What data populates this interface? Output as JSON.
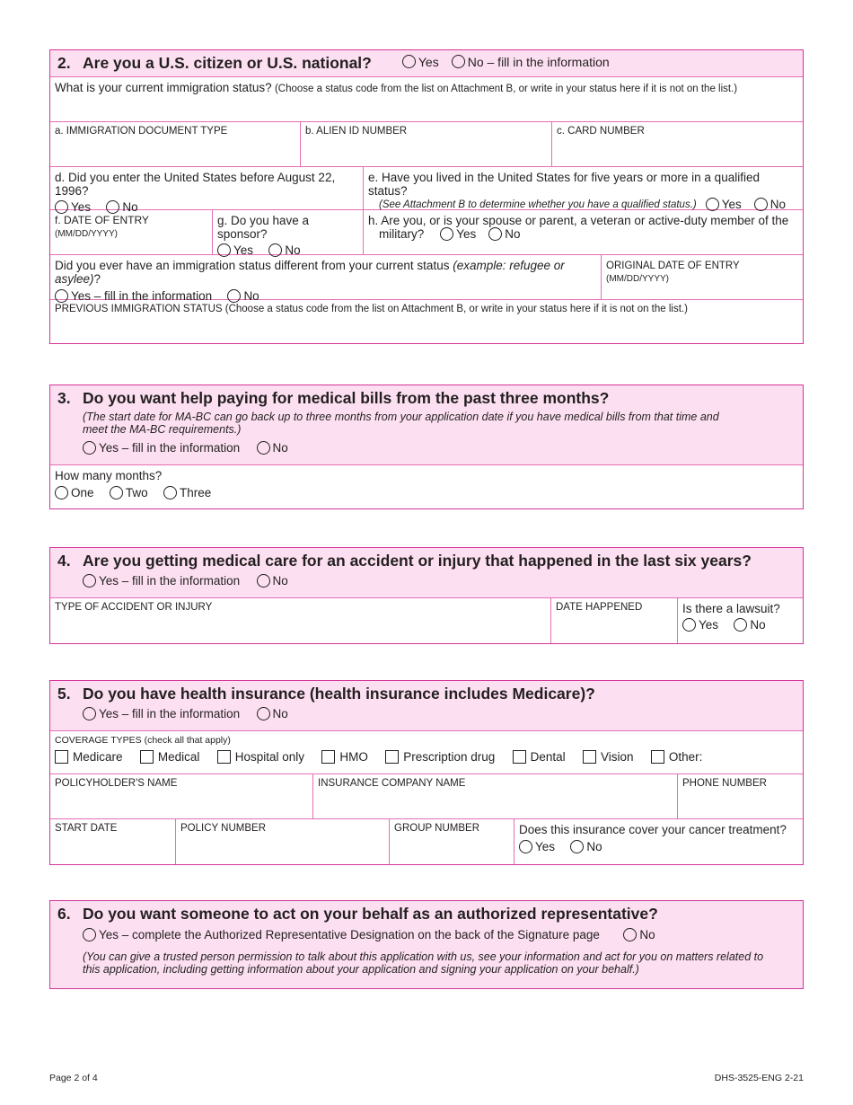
{
  "s2": {
    "num": "2.",
    "title": "Are you a U.S. citizen or U.S. national?",
    "yes": "Yes",
    "no": "No – fill in the information",
    "status_q": "What is your current immigration status?",
    "status_note": "(Choose a status code from the list on Attachment B, or write in your status here if it is not on the list.)",
    "a": "a. IMMIGRATION DOCUMENT TYPE",
    "b": "b. ALIEN ID NUMBER",
    "c": "c. CARD NUMBER",
    "d": "d. Did you enter the United States before August 22, 1996?",
    "e": "e. Have you lived in the United States for five years or more in a qualified status?",
    "e_note": "(See Attachment B to determine whether you have a qualified status.)",
    "f": "f. DATE OF ENTRY",
    "f_fmt": "(MM/DD/YYYY)",
    "g": "g. Do you have a sponsor?",
    "h1": "h. Are you, or is your spouse or parent, a veteran or active-duty member of the",
    "h2": "military?",
    "diff_q": "Did you ever have an immigration status different from your current status",
    "diff_ex": "(example: refugee or asylee)",
    "diff_end": "?",
    "yes_fill": "Yes – fill in the information",
    "orig": "ORIGINAL DATE OF ENTRY",
    "orig_fmt": "(MM/DD/YYYY)",
    "prev": "PREVIOUS IMMIGRATION STATUS (Choose a status code from the list on Attachment B, or write in your status here if it is not on the list.)"
  },
  "s3": {
    "num": "3.",
    "title": "Do you want help paying for medical bills from the past three months?",
    "note": "(The start date for MA-BC can go back up to three months from your application date if you have medical bills from that time and meet the MA-BC requirements.)",
    "yes": "Yes – fill in the information",
    "no": "No",
    "months_q": "How many months?",
    "opts": [
      "One",
      "Two",
      "Three"
    ]
  },
  "s4": {
    "num": "4.",
    "title": "Are you getting medical care for an accident or injury that happened in the last six years?",
    "yes": "Yes – fill in the information",
    "no": "No",
    "type": "TYPE OF ACCIDENT OR INJURY",
    "date": "DATE HAPPENED",
    "lawsuit": "Is there a lawsuit?"
  },
  "s5": {
    "num": "5.",
    "title": "Do you have health insurance (health insurance includes Medicare)?",
    "yes": "Yes – fill in the information",
    "no": "No",
    "cov_label": "COVERAGE TYPES (check all that apply)",
    "cov": [
      "Medicare",
      "Medical",
      "Hospital only",
      "HMO",
      "Prescription drug",
      "Dental",
      "Vision",
      "Other:"
    ],
    "holder": "POLICYHOLDER'S NAME",
    "company": "INSURANCE COMPANY NAME",
    "phone": "PHONE NUMBER",
    "start": "START DATE",
    "policy": "POLICY NUMBER",
    "group": "GROUP NUMBER",
    "cancer": "Does this insurance cover your cancer treatment?"
  },
  "s6": {
    "num": "6.",
    "title": "Do you want someone to act on your behalf as an authorized representative?",
    "yes": "Yes – complete the Authorized Representative Designation on the back of the Signature page",
    "no": "No",
    "note": "(You can give a trusted person permission to talk about this application with us, see your information and act for you on matters related to this application, including getting information about your application and signing your application on your behalf.)"
  },
  "common": {
    "yes": "Yes",
    "no": "No"
  },
  "footer": {
    "page": "Page 2 of 4",
    "form": "DHS-3525-ENG  2-21"
  }
}
